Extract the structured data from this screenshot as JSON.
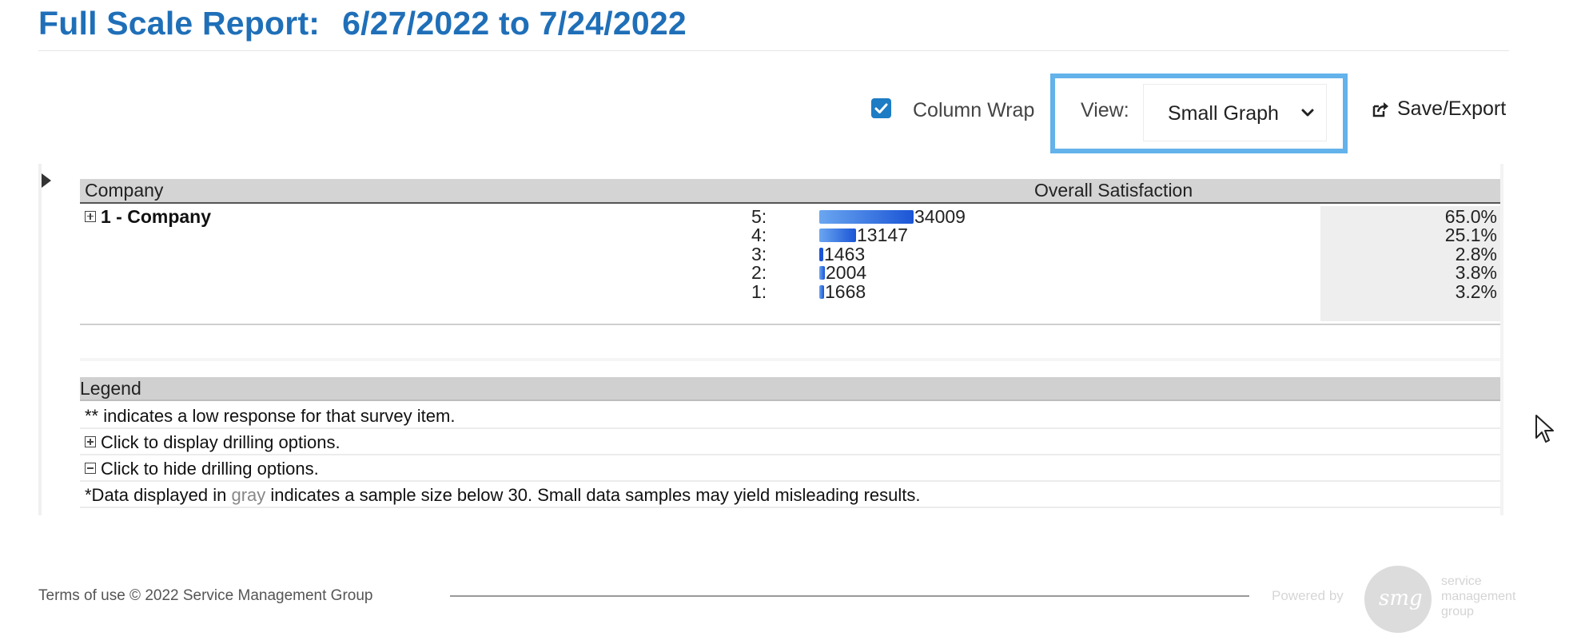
{
  "header": {
    "title": "Full Scale Report:",
    "date_range": "6/27/2022 to 7/24/2022"
  },
  "toolbar": {
    "column_wrap_label": "Column Wrap",
    "column_wrap_checked": true,
    "view_label": "View:",
    "view_value": "Small Graph",
    "export_label": "Save/Export"
  },
  "table": {
    "col_company": "Company",
    "col_metric": "Overall Satisfaction",
    "company_label": "1 - Company",
    "bar_color": "#1b55d6",
    "rows": [
      {
        "level": "5:",
        "count": "34009",
        "pct": "65.0%"
      },
      {
        "level": "4:",
        "count": "13147",
        "pct": "25.1%"
      },
      {
        "level": "3:",
        "count": "1463",
        "pct": "2.8%"
      },
      {
        "level": "2:",
        "count": "2004",
        "pct": "3.8%"
      },
      {
        "level": "1:",
        "count": "1668",
        "pct": "3.2%"
      }
    ]
  },
  "legend": {
    "title": "Legend",
    "low_response": "** indicates a low response for that survey item.",
    "display_drill": "Click to display drilling options.",
    "hide_drill": "Click to hide drilling options.",
    "gray_pre": "*Data displayed in ",
    "gray_word": "gray",
    "gray_post": " indicates a sample size below 30. Small data samples may yield misleading results."
  },
  "footer": {
    "terms": "Terms of use © 2022 Service Management Group",
    "powered_by": "Powered by",
    "logo_letters": "smg",
    "logo_text": [
      "service",
      "management",
      "group"
    ]
  },
  "colors": {
    "title": "#1f6fb8",
    "highlight_border": "#63b2ea",
    "checkbox": "#1d7cc4"
  }
}
